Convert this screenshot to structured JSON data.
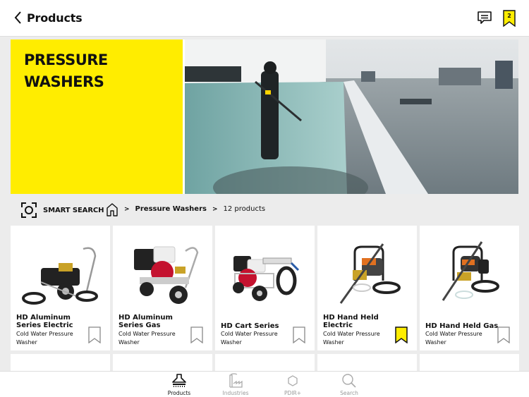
{
  "header": {
    "title": "Products",
    "bookmark_count": "2"
  },
  "hero": {
    "title": "PRESSURE\nWASHERS",
    "accent_color": "#ffed00"
  },
  "breadcrumb": {
    "smart_search_label": "SMART SEARCH",
    "separator": ">",
    "category": "Pressure Washers",
    "count": "12 products"
  },
  "products": [
    {
      "name": "HD Aluminum Series Electric",
      "subtitle": "Cold Water Pressure Washer",
      "bookmarked": false
    },
    {
      "name": "HD Aluminum Series Gas",
      "subtitle": "Cold Water Pressure Washer",
      "bookmarked": false
    },
    {
      "name": "HD Cart Series",
      "subtitle": "Cold Water Pressure Washer",
      "bookmarked": false
    },
    {
      "name": "HD Hand Held Electric",
      "subtitle": "Cold Water Pressure Washer",
      "bookmarked": true
    },
    {
      "name": "HD Hand Held Gas",
      "subtitle": "Cold Water Pressure Washer",
      "bookmarked": false
    }
  ],
  "tabbar": {
    "tabs": [
      {
        "label": "Products",
        "icon": "products-icon",
        "active": true
      },
      {
        "label": "Industries",
        "icon": "factory-icon",
        "active": false
      },
      {
        "label": "PDIR+",
        "icon": "hexagon-icon",
        "active": false
      },
      {
        "label": "Search",
        "icon": "search-icon",
        "active": false
      }
    ]
  }
}
